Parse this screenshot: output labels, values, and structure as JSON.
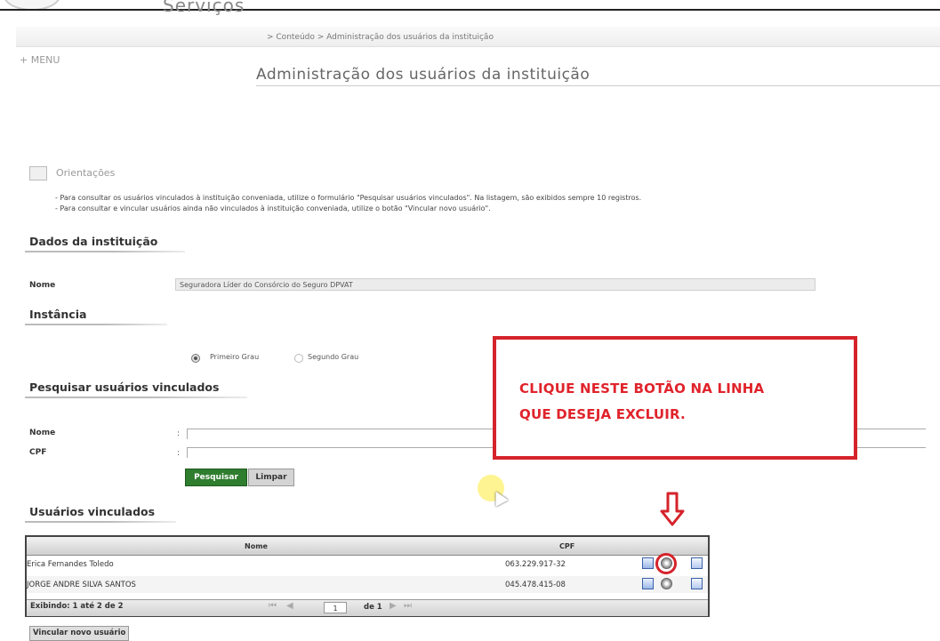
{
  "header": {
    "app_title": "Serviços",
    "breadcrumb": "> Conteúdo > Administração dos usuários da instituição",
    "menu_label": "+ MENU",
    "page_title": "Administração dos usuários da instituição"
  },
  "orientation": {
    "title": "Orientações",
    "lines": [
      "- Para consultar os usuários vinculados à instituição conveniada, utilize o formulário \"Pesquisar usuários vinculados\". Na listagem, são exibidos sempre 10 registros.",
      "- Para consultar e vincular usuários ainda não vinculados à instituição conveniada, utilize o botão \"Vincular novo usuário\"."
    ]
  },
  "instituicao": {
    "section_title": "Dados da instituição",
    "nome_label": "Nome",
    "nome_value": "Seguradora Líder do Consórcio do Seguro DPVAT"
  },
  "instancia": {
    "section_title": "Instância",
    "options": [
      "Primeiro Grau",
      "Segundo Grau"
    ],
    "selected": "Primeiro Grau"
  },
  "search": {
    "section_title": "Pesquisar usuários vinculados",
    "nome_label": "Nome",
    "cpf_label": "CPF",
    "nome_value": "",
    "cpf_value": "",
    "search_button": "Pesquisar",
    "clear_button": "Limpar"
  },
  "callout": {
    "line1": "CLIQUE NESTE BOTÃO NA LINHA",
    "line2": "QUE DESEJA EXCLUIR.",
    "accent_color": "#d5232b"
  },
  "users": {
    "section_title": "Usuários vinculados",
    "columns": [
      "Nome",
      "CPF"
    ],
    "rows": [
      {
        "nome": "Erica Fernandes Toledo",
        "cpf": "063.229.917-32",
        "actions": [
          "edit-icon",
          "delete-icon",
          "view-icon"
        ]
      },
      {
        "nome": "JORGE ANDRE SILVA SANTOS",
        "cpf": "045.478.415-08",
        "actions": [
          "edit-icon",
          "delete-icon",
          "view-icon"
        ]
      }
    ],
    "footer_text": "Exibindo: 1 até 2 de 2",
    "page_current": "1",
    "page_of": "de 1",
    "link_button": "Vincular novo usuário"
  }
}
